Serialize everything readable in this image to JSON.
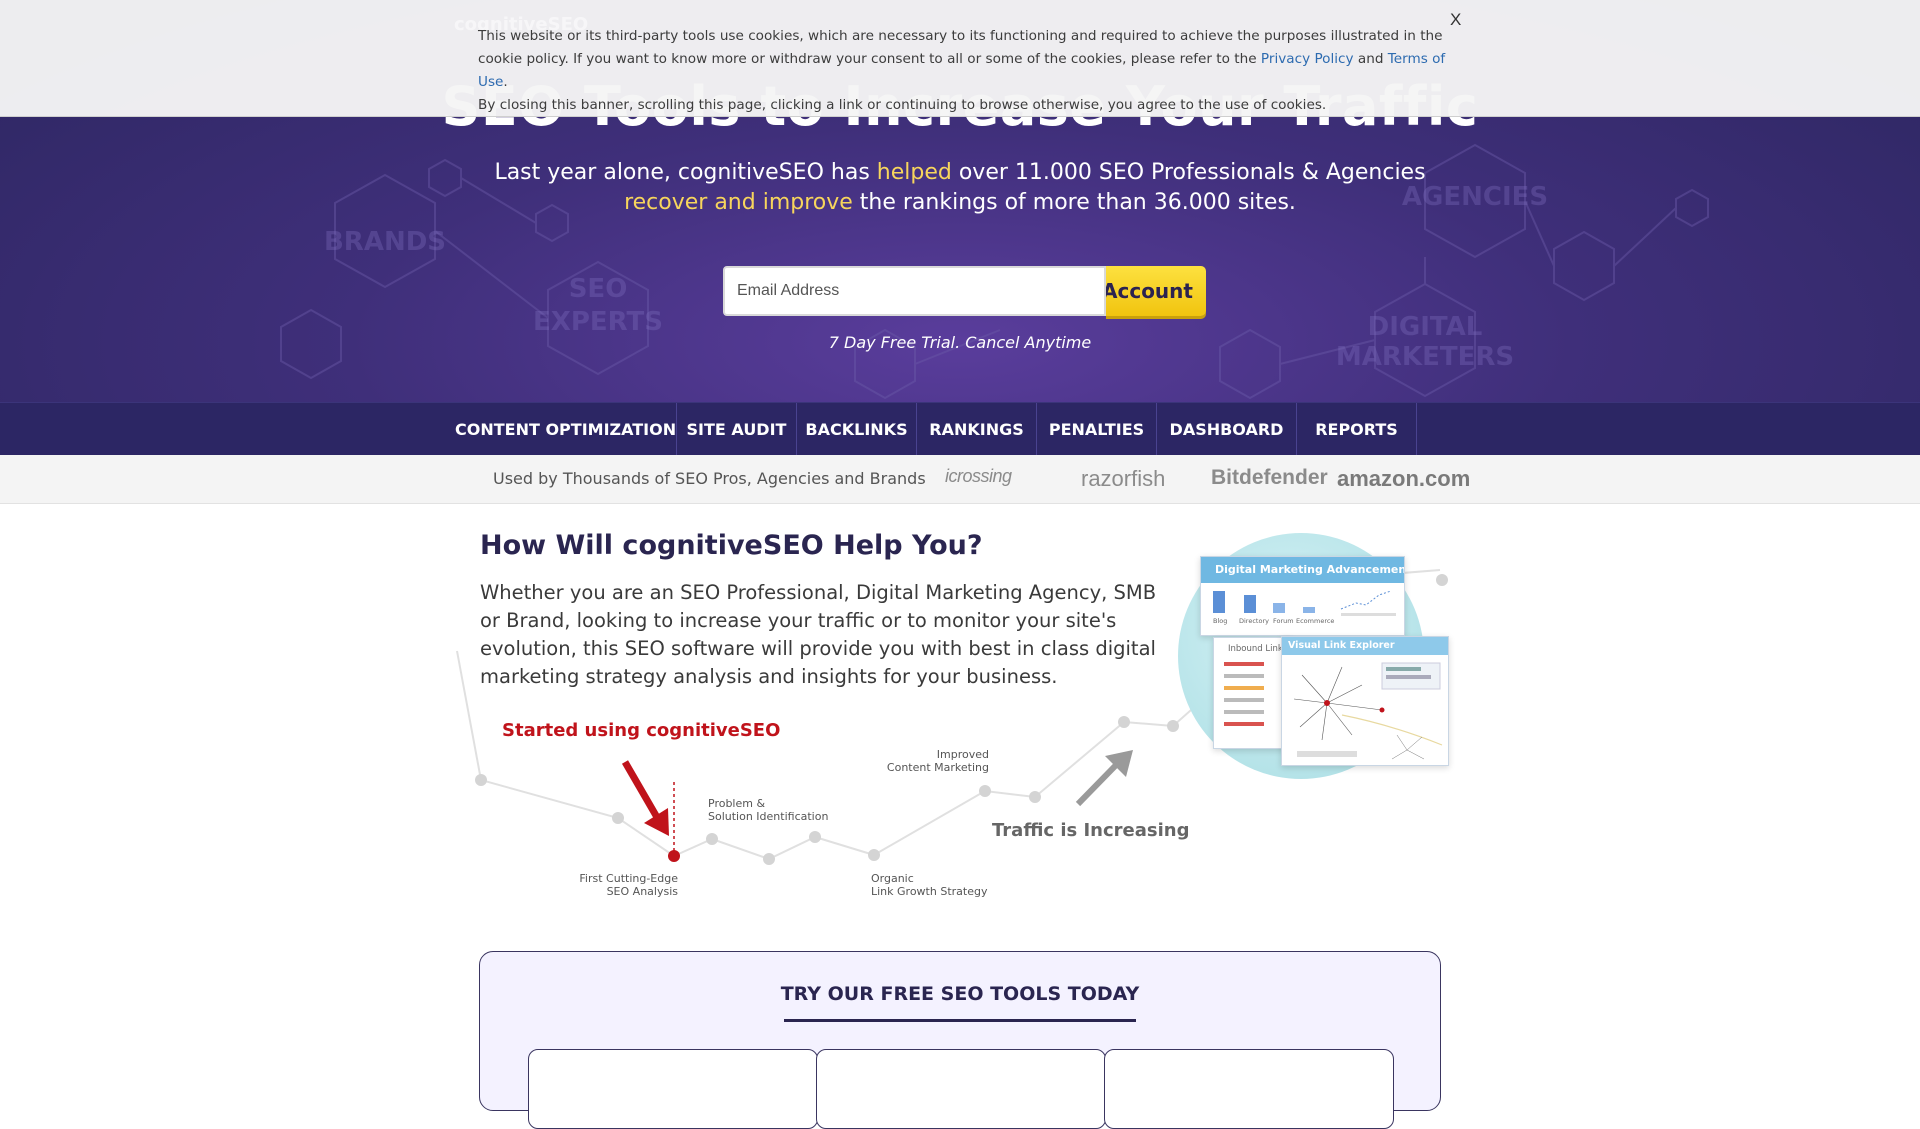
{
  "hero": {
    "title": "SEO Tools to Increase Your Traffic",
    "subtitle_line1_a": "Last year alone, cognitiveSEO has ",
    "subtitle_line1_hl": "helped",
    "subtitle_line1_b": " over 11.000 SEO Professionals & Agencies",
    "subtitle_line2_hl": "recover and improve",
    "subtitle_line2_b": " the rankings of more than 36.000 sites.",
    "email_placeholder": "Email Address",
    "cta_label": "Account",
    "trial_note": "7 Day Free Trial. Cancel Anytime",
    "bg_labels": [
      "BRANDS",
      "SEO",
      "EXPERTS",
      "AGENCIES",
      "DIGITAL",
      "MARKETERS"
    ],
    "accent_color": "#f7d55c"
  },
  "cookie_banner": {
    "text_part1": "This website or its third-party tools use cookies, which are necessary to its functioning and required to achieve the purposes illustrated in the cookie policy. If you want to know more or withdraw your consent to all or some of the cookies, please refer to the ",
    "privacy_link": "Privacy Policy",
    "text_and": " and ",
    "terms_link": "Terms of Use",
    "text_part2": ".",
    "text_line3": "By closing this banner, scrolling this page, clicking a link or continuing to browse otherwise, you agree to the use of cookies.",
    "close_label": "X",
    "ghost_logo": "cognitiveSEO"
  },
  "nav": {
    "items": [
      {
        "label": "CONTENT OPTIMIZATION"
      },
      {
        "label": "SITE AUDIT"
      },
      {
        "label": "BACKLINKS"
      },
      {
        "label": "RANKINGS"
      },
      {
        "label": "PENALTIES"
      },
      {
        "label": "DASHBOARD"
      },
      {
        "label": "REPORTS"
      }
    ]
  },
  "brands_bar": {
    "label": "Used by Thousands of SEO Pros, Agencies and Brands",
    "logos": [
      "icrossing",
      "razorfish",
      "Bitdefender",
      "amazon.com"
    ]
  },
  "main": {
    "title": "How Will cognitiveSEO Help You?",
    "body": "Whether you are an SEO Professional, Digital Marketing Agency, SMB or Brand, looking to increase your traffic or to monitor your site's evolution, this SEO software will provide you with best in class digital marketing strategy analysis and insights for your business.",
    "graph": {
      "started": "Started using cognitiveSEO",
      "label_analysis_1": "First Cutting-Edge",
      "label_analysis_2": "SEO Analysis",
      "label_problem_1": "Problem &",
      "label_problem_2": "Solution Identification",
      "label_organic_1": "Organic",
      "label_organic_2": "Link Growth Strategy",
      "label_content_1": "Improved",
      "label_content_2": "Content Marketing",
      "traffic": "Traffic is Increasing"
    },
    "dashboard": {
      "panel1_title": "Digital Marketing Advancement",
      "panel1_bars": [
        "Blog",
        "Directory",
        "Forum",
        "Ecommerce"
      ],
      "panel2_title": "Visual Link Explorer",
      "panel3_title": "Inbound Link"
    }
  },
  "tools": {
    "title": "TRY OUR FREE SEO TOOLS TODAY"
  }
}
